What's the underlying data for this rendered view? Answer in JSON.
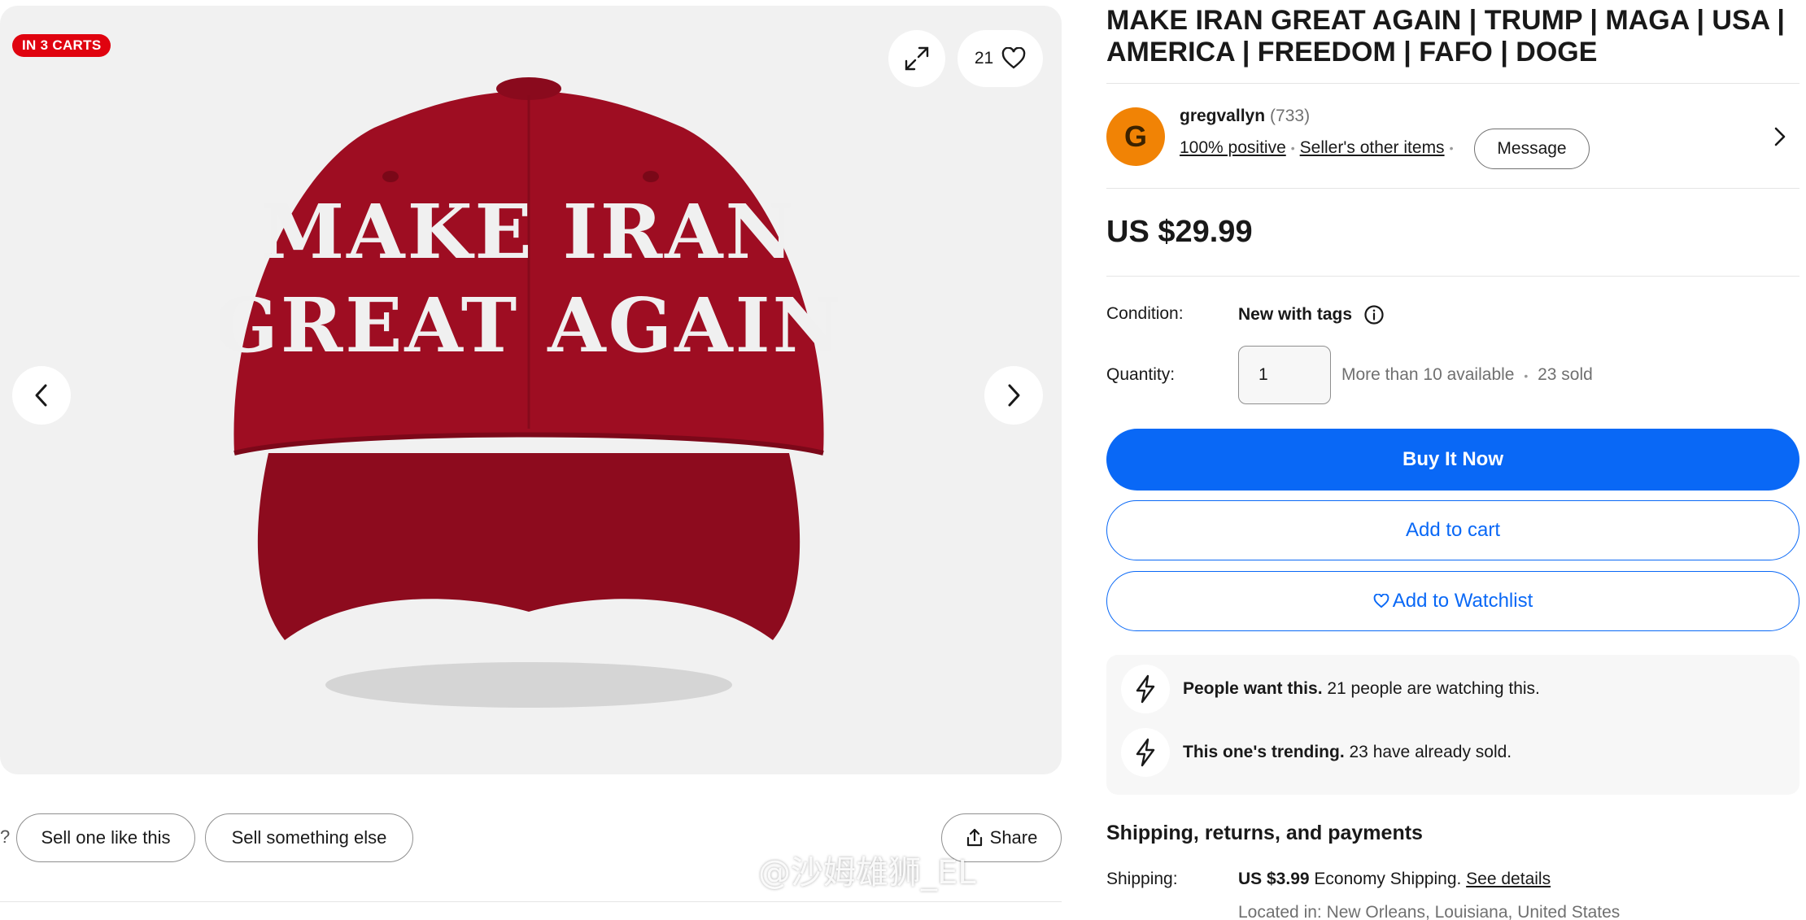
{
  "gallery": {
    "badge": "IN 3 CARTS",
    "watch_count": "21",
    "cap_line1": "MAKE IRAN",
    "cap_line2": "GREAT AGAIN"
  },
  "actions": {
    "question_mark": "?",
    "sell_one_like_this": "Sell one like this",
    "sell_something_else": "Sell something else",
    "share": "Share"
  },
  "listing": {
    "title": "MAKE IRAN GREAT AGAIN | TRUMP | MAGA | USA | AMERICA | FREEDOM | FAFO | DOGE",
    "price": "US $29.99"
  },
  "seller": {
    "avatar_letter": "G",
    "name": "gregvallyn",
    "feedback_count": "(733)",
    "positive": "100% positive",
    "other_items": "Seller's other items",
    "message": "Message"
  },
  "details": {
    "condition_label": "Condition:",
    "condition_value": "New with tags",
    "quantity_label": "Quantity:",
    "quantity_value": "1",
    "availability": "More than 10 available",
    "sold": "23 sold"
  },
  "buttons": {
    "buy_it_now": "Buy It Now",
    "add_to_cart": "Add to cart",
    "add_to_watchlist": "Add to Watchlist"
  },
  "signals": [
    {
      "bold": "People want this.",
      "text": " 21 people are watching this."
    },
    {
      "bold": "This one's trending.",
      "text": " 23 have already sold."
    }
  ],
  "shipping": {
    "heading": "Shipping, returns, and payments",
    "label": "Shipping:",
    "price": "US $3.99",
    "method": " Economy Shipping. ",
    "see_details": "See details",
    "located_in": "Located in: New Orleans, Louisiana, United States"
  },
  "watermark": "@沙姆雄狮_EL",
  "colors": {
    "brand_blue": "#0968f6",
    "badge_red": "#e0030f",
    "avatar_orange": "#f18305",
    "cap_red": "#9e0d22"
  },
  "icons": [
    "expand-icon",
    "heart-icon",
    "chevron-left-icon",
    "chevron-right-icon",
    "share-icon",
    "info-icon",
    "lightning-icon",
    "weibo-icon"
  ]
}
